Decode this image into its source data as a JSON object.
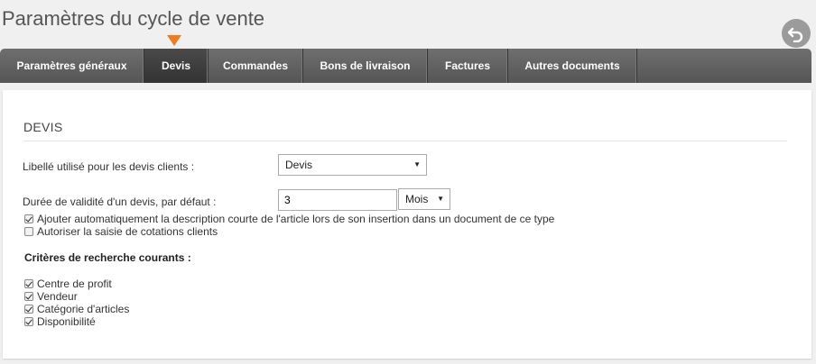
{
  "page": {
    "title": "Paramètres du cycle de vente"
  },
  "tabs": [
    {
      "label": "Paramètres généraux"
    },
    {
      "label": "Devis"
    },
    {
      "label": "Commandes"
    },
    {
      "label": "Bons de livraison"
    },
    {
      "label": "Factures"
    },
    {
      "label": "Autres documents"
    }
  ],
  "active_tab": "Devis",
  "section": {
    "title": "DEVIS"
  },
  "fields": {
    "libelle_label": "Libellé utilisé pour les devis clients :",
    "libelle_value": "Devis",
    "duree_label": "Durée de validité d'un devis, par défaut :",
    "duree_value": "3",
    "duree_unit": "Mois"
  },
  "options": [
    {
      "label": "Ajouter automatiquement la description courte de l'article lors de son insertion dans un document de ce type",
      "checked": true
    },
    {
      "label": "Autoriser la saisie de cotations clients",
      "checked": false
    }
  ],
  "criteria": {
    "title": "Critères de recherche courants :",
    "items": [
      {
        "label": "Centre de profit",
        "checked": true
      },
      {
        "label": "Vendeur",
        "checked": true
      },
      {
        "label": "Catégorie d'articles",
        "checked": true
      },
      {
        "label": "Disponibilité",
        "checked": true
      }
    ]
  },
  "colors": {
    "accent": "#f07c1e",
    "tabbar": "#5f5f5f",
    "active_tab": "#3d3d3d"
  },
  "icons": {
    "back": "undo-arrow-icon"
  }
}
